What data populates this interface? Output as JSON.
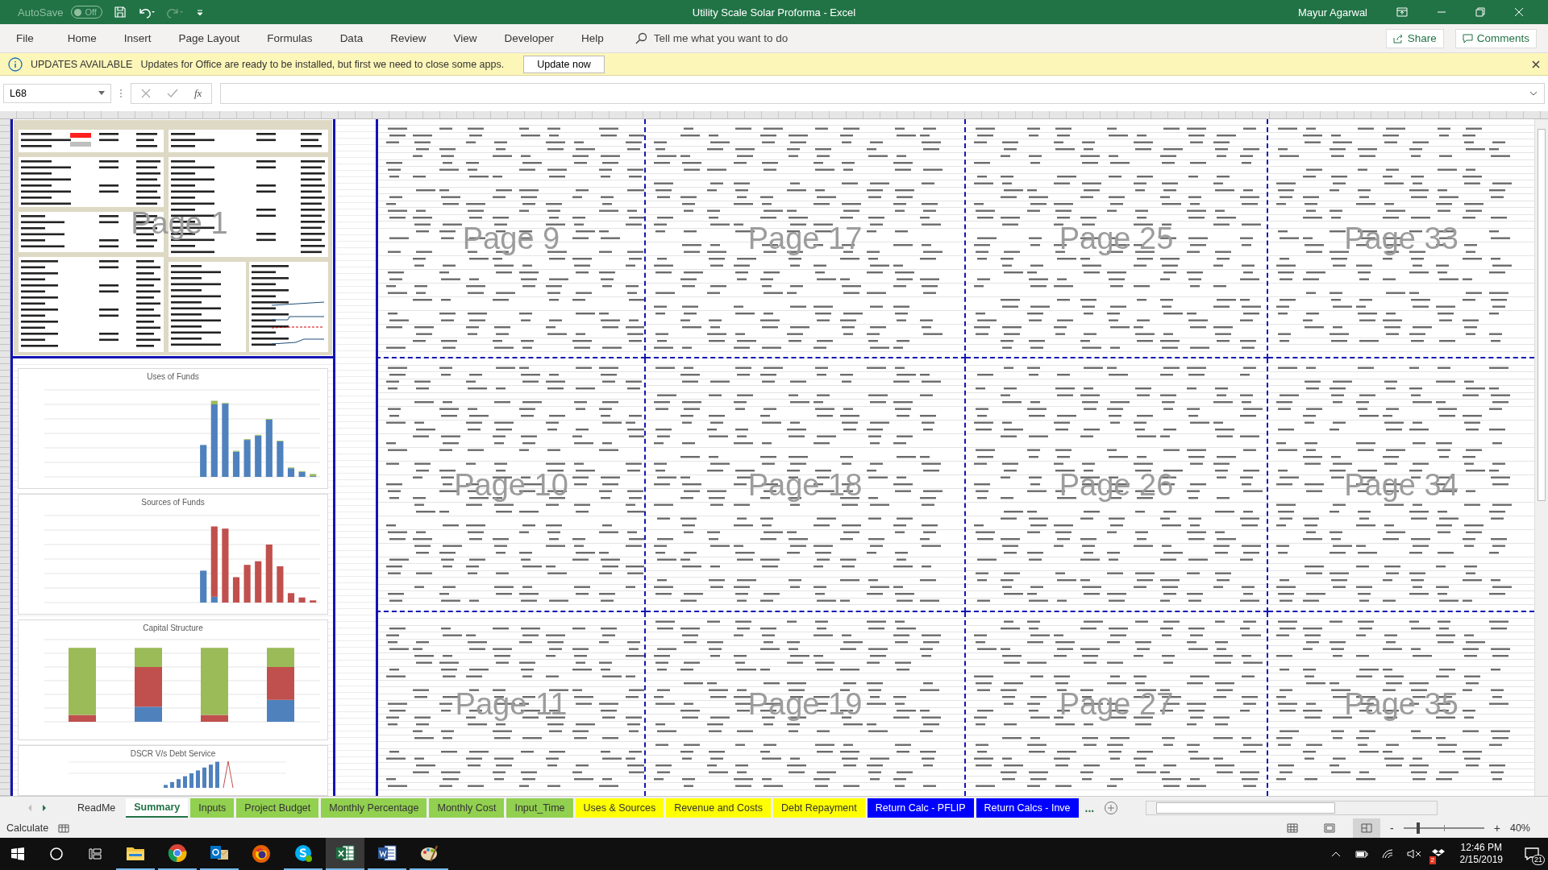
{
  "title_bar": {
    "autosave_label": "AutoSave",
    "autosave": {
      "on": false,
      "state_label": "Off"
    },
    "title": "Utility Scale Solar Proforma  -  Excel",
    "user": "Mayur Agarwal"
  },
  "menu": {
    "items": [
      "File",
      "Home",
      "Insert",
      "Page Layout",
      "Formulas",
      "Data",
      "Review",
      "View",
      "Developer",
      "Help"
    ],
    "search_placeholder": "Tell me what you want to do",
    "share": "Share",
    "comments": "Comments"
  },
  "update_bar": {
    "heading": "UPDATES AVAILABLE",
    "message": "Updates for Office are ready to be installed, but first we need to close some apps.",
    "button": "Update now"
  },
  "formula_bar": {
    "name_box": "L68",
    "function_label": "fx"
  },
  "sheet": {
    "summary": {
      "page_label": "Page 1"
    },
    "charts": [
      {
        "title": "Uses of Funds"
      },
      {
        "title": "Sources of Funds"
      },
      {
        "title": "Capital Structure"
      },
      {
        "title": "DSCR V/s Debt Service"
      }
    ],
    "pages": [
      {
        "label": "Page 9"
      },
      {
        "label": "Page 17"
      },
      {
        "label": "Page 25"
      },
      {
        "label": "Page 33"
      },
      {
        "label": "Page 10"
      },
      {
        "label": "Page 18"
      },
      {
        "label": "Page 26"
      },
      {
        "label": "Page 34"
      },
      {
        "label": "Page 11"
      },
      {
        "label": "Page 19"
      },
      {
        "label": "Page 27"
      },
      {
        "label": "Page 35"
      }
    ]
  },
  "sheet_tabs": [
    {
      "label": "ReadMe",
      "selected": false
    },
    {
      "label": "Summary",
      "selected": true
    },
    {
      "label": "Inputs",
      "selected": false,
      "color": "#92d050"
    },
    {
      "label": "Project Budget",
      "selected": false,
      "color": "#92d050"
    },
    {
      "label": "Monthly Percentage",
      "selected": false,
      "color": "#92d050"
    },
    {
      "label": "Monthly Cost",
      "selected": false,
      "color": "#92d050"
    },
    {
      "label": "Input_Time",
      "selected": false,
      "color": "#92d050"
    },
    {
      "label": "Uses & Sources",
      "selected": false,
      "color": "#ffff00"
    },
    {
      "label": "Revenue and Costs",
      "selected": false,
      "color": "#ffff00"
    },
    {
      "label": "Debt Repayment",
      "selected": false,
      "color": "#ffff00"
    },
    {
      "label": "Return Calc - PFLIP",
      "selected": false,
      "color": "#0000ff"
    },
    {
      "label": "Return Calcs - Inve",
      "selected": false,
      "color": "#0000ff"
    }
  ],
  "tabs_more": "...",
  "status_bar": {
    "mode": "Calculate",
    "views": [
      {
        "kind": "normal",
        "selected": false
      },
      {
        "kind": "page_layout",
        "selected": false
      },
      {
        "kind": "page_break",
        "selected": true
      }
    ],
    "zoom": {
      "level": 0.18,
      "reading": "40%",
      "minus": "-",
      "plus": "+"
    }
  },
  "taskbar": {
    "apps": [
      {
        "kind": "folder",
        "running": true,
        "active": false
      },
      {
        "kind": "chrome",
        "running": true,
        "active": false
      },
      {
        "kind": "mail",
        "running": true,
        "active": false
      },
      {
        "kind": "firefox",
        "running": false,
        "active": false
      },
      {
        "kind": "chat",
        "running": true,
        "active": false
      },
      {
        "kind": "spreadsheet",
        "running": true,
        "active": true
      },
      {
        "kind": "document",
        "running": true,
        "active": false
      },
      {
        "kind": "paint",
        "running": true,
        "active": false
      }
    ],
    "tray_badge": "2",
    "time": "12:46 PM",
    "date": "2/15/2019",
    "notifications": "21"
  }
}
